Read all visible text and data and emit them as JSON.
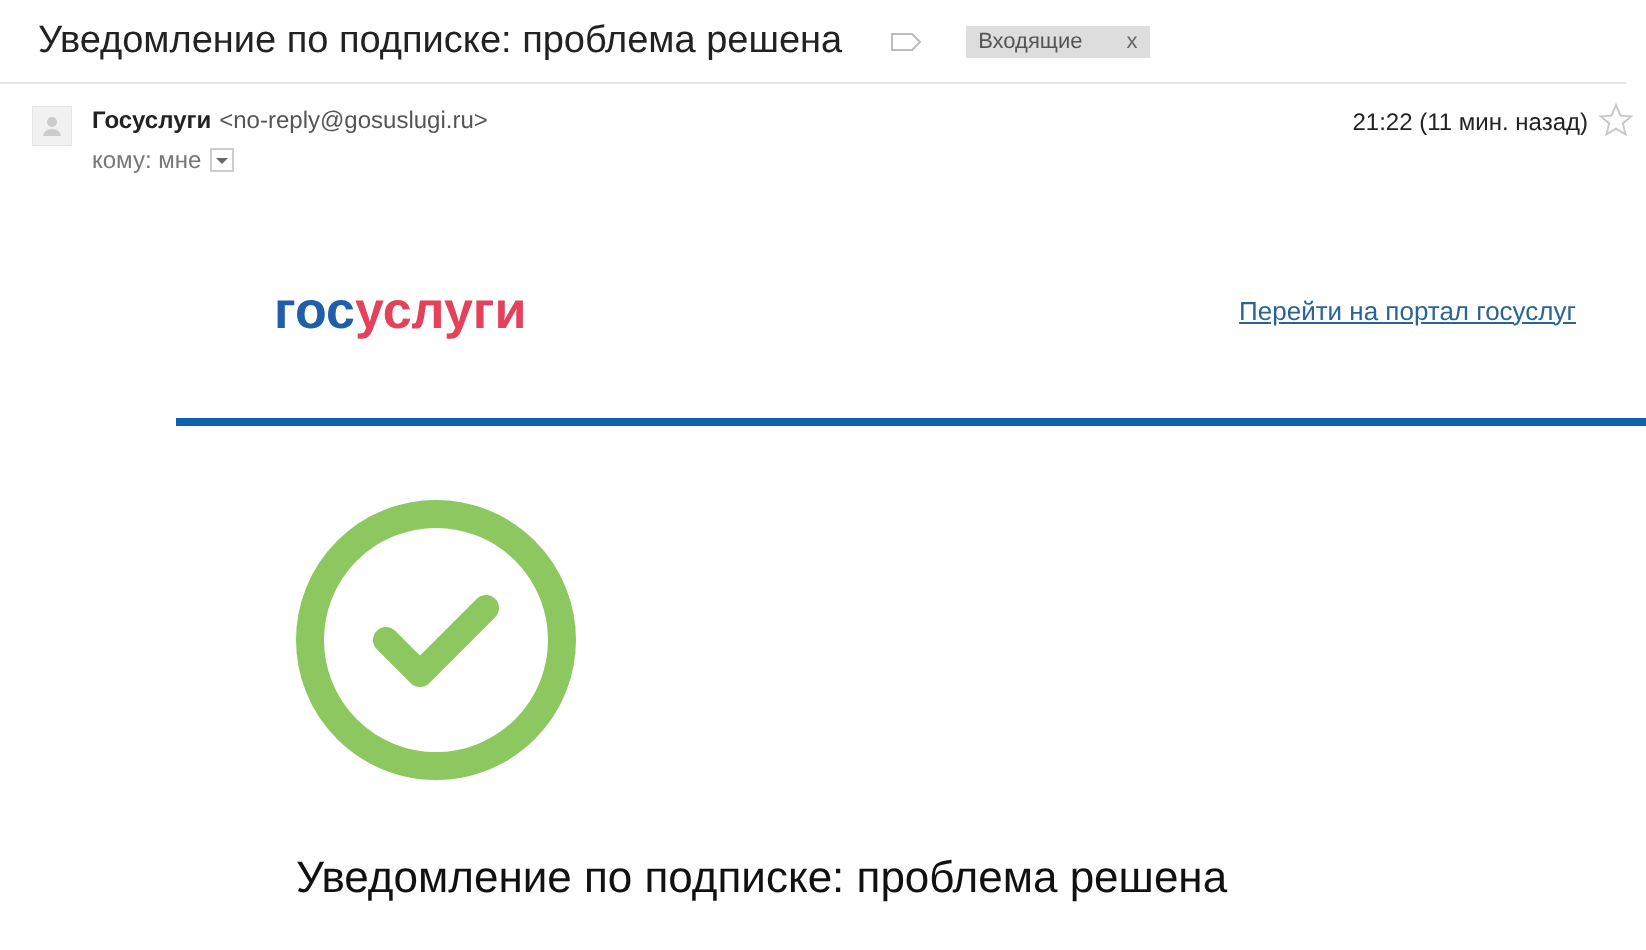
{
  "subject": "Уведомление по подписке: проблема решена",
  "labels": [
    {
      "text": "Входящие",
      "close": "x"
    }
  ],
  "message": {
    "sender": "Госуслуги",
    "address": "<no-reply@gosuslugi.ru>",
    "recipient": "кому: мне",
    "time": "21:22 (11 мин. назад)",
    "starred": false
  },
  "email": {
    "logo": [
      {
        "text": "гос",
        "color": "#1f5ea8"
      },
      {
        "text": "услуги",
        "color": "#e4425b"
      }
    ],
    "portal_link": "Перейти на портал госуслуг",
    "heading": "Уведомление по подписке: проблема решена"
  }
}
